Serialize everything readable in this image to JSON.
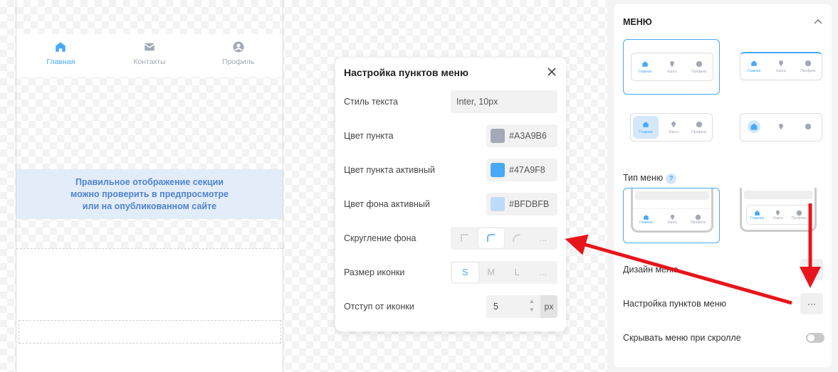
{
  "colors": {
    "item": "#A3A9B6",
    "item_active": "#47A9F8",
    "bg_active": "#BFDBFB",
    "accent": "#47a9f8",
    "arrow": "#e8141c"
  },
  "preview": {
    "menu": [
      {
        "label": "Главная",
        "icon": "home-icon",
        "active": true
      },
      {
        "label": "Контакты",
        "icon": "mail-icon",
        "active": false
      },
      {
        "label": "Профиль",
        "icon": "profile-icon",
        "active": false
      }
    ],
    "banner": "Правильное отображение секции\nможно проверить в предпросмотре\nили на опубликованном сайте"
  },
  "dialog": {
    "title": "Настройка пунктов меню",
    "rows": {
      "text_style": {
        "label": "Стиль текста",
        "value": "Inter, 10px"
      },
      "item_color": {
        "label": "Цвет пункта",
        "value": "#A3A9B6"
      },
      "item_active_color": {
        "label": "Цвет пункта активный",
        "value": "#47A9F8"
      },
      "bg_active_color": {
        "label": "Цвет фона активный",
        "value": "#BFDBFB"
      },
      "bg_radius": {
        "label": "Скругление фона",
        "more": "..."
      },
      "icon_size": {
        "label": "Размер иконки",
        "options": [
          "S",
          "M",
          "L",
          "..."
        ],
        "selected": "S"
      },
      "icon_offset": {
        "label": "Отступ от иконки",
        "value": "5",
        "unit": "px"
      }
    }
  },
  "panel": {
    "title": "МЕНЮ",
    "thumb_items": [
      "Главная",
      "Карта",
      "Профиль"
    ],
    "menu_type_label": "Тип меню",
    "help": "?",
    "design_label": "Дизайн меню",
    "items_settings_label": "Настройка пунктов меню",
    "hide_on_scroll_label": "Скрывать меню при скролле",
    "dots": "···"
  }
}
